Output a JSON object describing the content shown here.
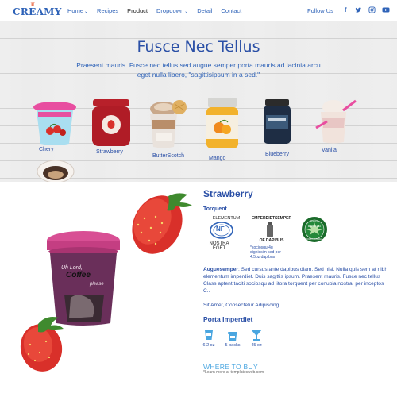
{
  "brand": {
    "logo_text": "CREAMY"
  },
  "nav": {
    "items": [
      {
        "label": "Home",
        "caret": true
      },
      {
        "label": "Recipes",
        "caret": false
      },
      {
        "label": "Product",
        "caret": false,
        "active": true
      },
      {
        "label": "Dropdown",
        "caret": true
      },
      {
        "label": "Detail",
        "caret": false
      },
      {
        "label": "Contact",
        "caret": false
      }
    ],
    "follow_label": "Follow Us",
    "social_icons": [
      "facebook-icon",
      "twitter-icon",
      "instagram-icon",
      "youtube-icon"
    ]
  },
  "hero": {
    "title": "Fusce Nec Tellus",
    "subtitle": "Praesent mauris. Fusce nec tellus sed augue semper porta mauris ad lacinia arcu eget nulla libero, \"sagittisipsum in a sed.\"",
    "products": [
      {
        "label": "Chery"
      },
      {
        "label": "Strawberry"
      },
      {
        "label": "ButterScotch"
      },
      {
        "label": "Mango"
      },
      {
        "label": "Blueberry"
      },
      {
        "label": "Vanila"
      }
    ]
  },
  "detail": {
    "title": "Strawberry",
    "subtitle": "Torquent",
    "badges": {
      "nf_top": "ELEMENTUM",
      "nf_mark": "NF",
      "nf_bottom": "NOSTRA EGET",
      "jar_top": "EMPERDIETSEMPER",
      "jar_bottom": "OF DAPIBUS",
      "jar_note": "*sociosqu 4g dignissim sed per 4.5oz dapibus",
      "green_top": "MEDICAL MARIJUANA",
      "green_bottom": "100% NATURAL"
    },
    "paragraph1_lead": "Auguesemper",
    "paragraph1_rest": ": Sed cursus ante dapibus diam. Sed nisi. Nulla quis sem at nibh elementum imperdiet. Duis sagittis ipsum. Praesent mauris. Fusce nec tellus Class aptent taciti sociosqu ad litora torquent per conubia nostra, per inceptos C..",
    "paragraph2": "Sit Amet, Consectetur Adipiscing.",
    "sizes_title": "Porta Imperdiet",
    "sizes": [
      {
        "icon": "cup-icon",
        "label": "6.2 oz"
      },
      {
        "icon": "tub-icon",
        "label": "5 packs"
      },
      {
        "icon": "cocktail-glass-icon",
        "label": "45 oz"
      }
    ],
    "where_title": "WHERE TO BUY",
    "where_sub": "*Learn more at templatesweb.com",
    "cup_text_1": "Uh Lord,",
    "cup_text_2": "Coffee",
    "cup_text_3": "please"
  },
  "colors": {
    "brand_blue": "#2f63b8",
    "heading_blue": "#2a4fa6",
    "link_light_blue": "#4aa6e0",
    "accent_red": "#d9302a"
  }
}
